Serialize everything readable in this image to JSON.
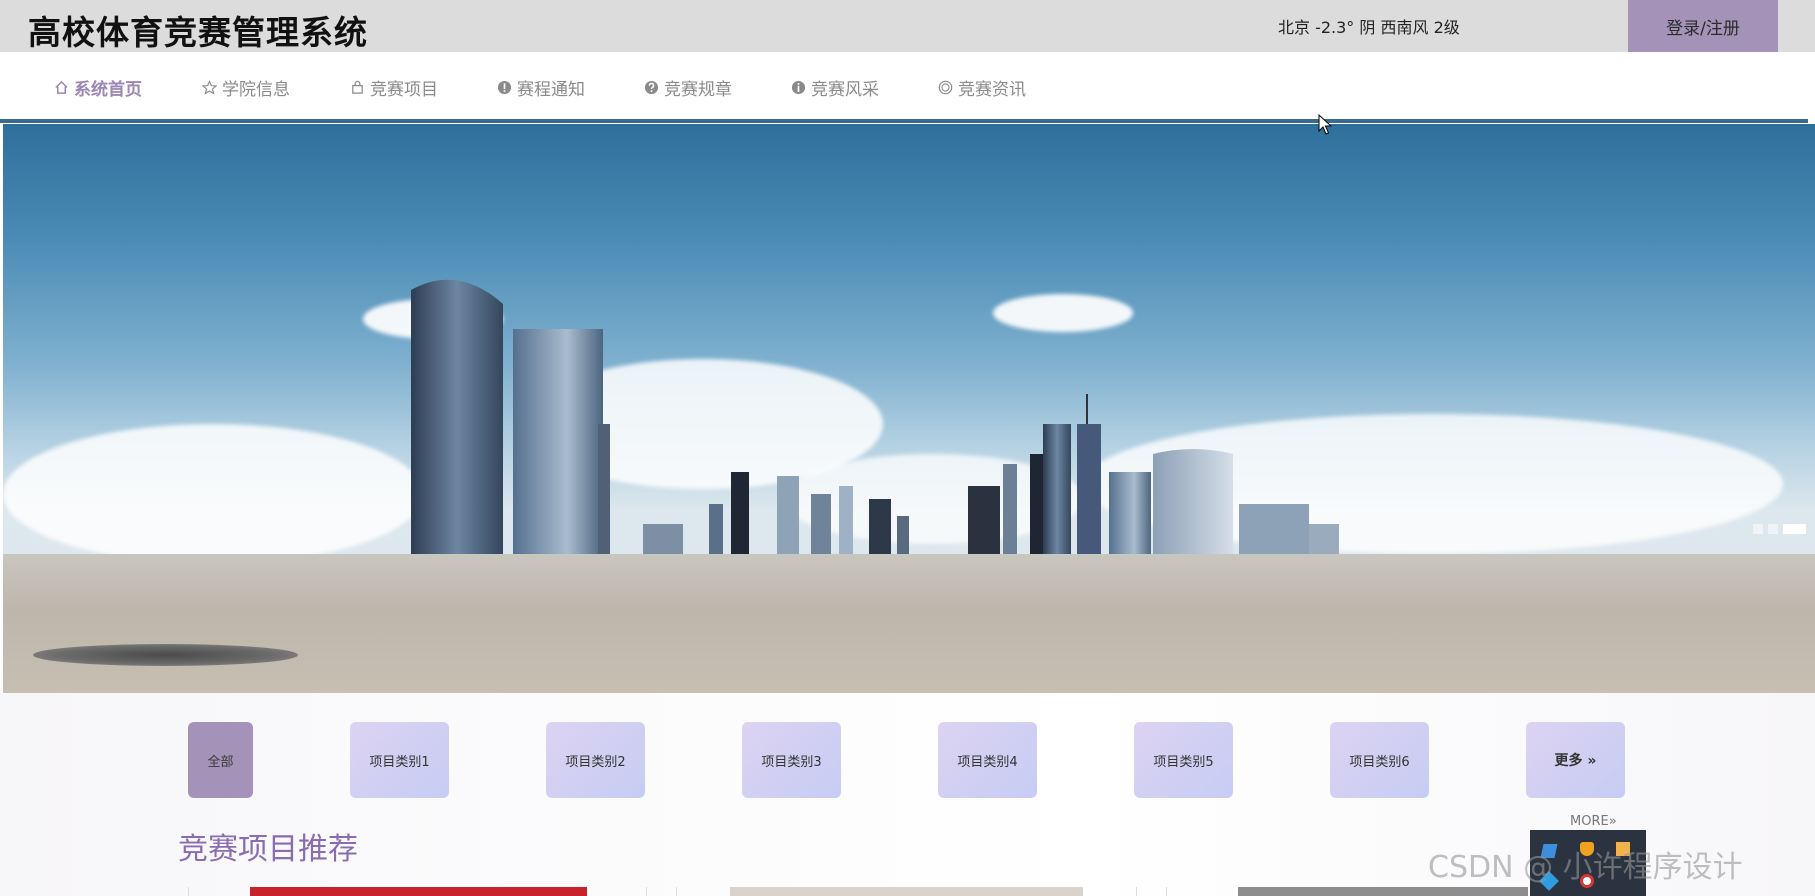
{
  "header": {
    "site_title": "高校体育竞赛管理系统",
    "weather": "北京  -2.3°  阴  西南风  2级",
    "login_label": "登录/注册"
  },
  "nav": {
    "items": [
      {
        "label": "系统首页",
        "icon": "home-icon",
        "active": true
      },
      {
        "label": "学院信息",
        "icon": "star-icon",
        "active": false
      },
      {
        "label": "竞赛项目",
        "icon": "bag-icon",
        "active": false
      },
      {
        "label": "赛程通知",
        "icon": "exclamation-icon",
        "active": false
      },
      {
        "label": "竞赛规章",
        "icon": "question-icon",
        "active": false
      },
      {
        "label": "竞赛风采",
        "icon": "info-icon",
        "active": false
      },
      {
        "label": "竞赛资讯",
        "icon": "smile-icon",
        "active": false
      }
    ]
  },
  "banner": {
    "slide_count": 3,
    "active_slide": 3
  },
  "categories": {
    "all_label": "全部",
    "items": [
      "项目类别1",
      "项目类别2",
      "项目类别3",
      "项目类别4",
      "项目类别5",
      "项目类别6"
    ],
    "more_label": "更多 »"
  },
  "recommend": {
    "more_link": "MORE»",
    "title": "竞赛项目推荐"
  },
  "watermark": "CSDN @  小许程序设计",
  "colors": {
    "accent": "#a592b8",
    "title_purple": "#8a6db0",
    "nav_active": "#9b86b4",
    "divider": "#3a6b8e"
  }
}
